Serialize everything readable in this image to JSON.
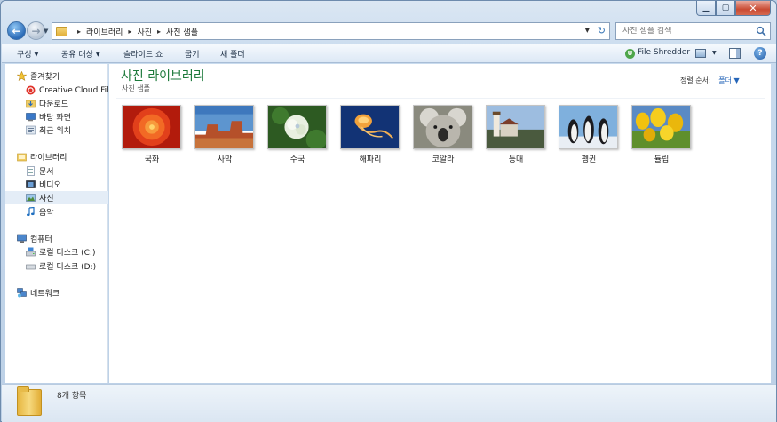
{
  "address_bar": {
    "crumbs": [
      "라이브러리",
      "사진",
      "사진 샘플"
    ],
    "search_placeholder": "사진 샘플 검색"
  },
  "toolbar": {
    "organize": "구성",
    "share": "공유 대상",
    "slideshow": "슬라이드 쇼",
    "burn": "굽기",
    "new_folder": "새 폴더",
    "file_shredder": "File Shredder"
  },
  "navigation": {
    "favorites": {
      "label": "즐겨찾기",
      "items": [
        "Creative Cloud Files",
        "다운로드",
        "바탕 화면",
        "최근 위치"
      ]
    },
    "libraries": {
      "label": "라이브러리",
      "items": [
        "문서",
        "비디오",
        "사진",
        "음악"
      ],
      "selected": "사진"
    },
    "computer": {
      "label": "컴퓨터",
      "items": [
        "로컬 디스크 (C:)",
        "로컬 디스크 (D:)"
      ]
    },
    "network": {
      "label": "네트워크"
    }
  },
  "content": {
    "title": "사진 라이브러리",
    "subtitle": "사진 샘플",
    "arrange_label": "정렬 순서:",
    "arrange_value": "폴더",
    "files": [
      {
        "name": "국화",
        "icon": "chrysanthemum-thumbnail"
      },
      {
        "name": "사막",
        "icon": "desert-thumbnail"
      },
      {
        "name": "수국",
        "icon": "hydrangeas-thumbnail"
      },
      {
        "name": "해파리",
        "icon": "jellyfish-thumbnail"
      },
      {
        "name": "코알라",
        "icon": "koala-thumbnail"
      },
      {
        "name": "등대",
        "icon": "lighthouse-thumbnail"
      },
      {
        "name": "펭귄",
        "icon": "penguins-thumbnail"
      },
      {
        "name": "튤립",
        "icon": "tulips-thumbnail"
      }
    ]
  },
  "status": {
    "item_count": "8개 항목"
  },
  "colors": {
    "library_title": "#1e7a3c",
    "accent_link": "#2565b8",
    "selection": "#e4edf7"
  }
}
